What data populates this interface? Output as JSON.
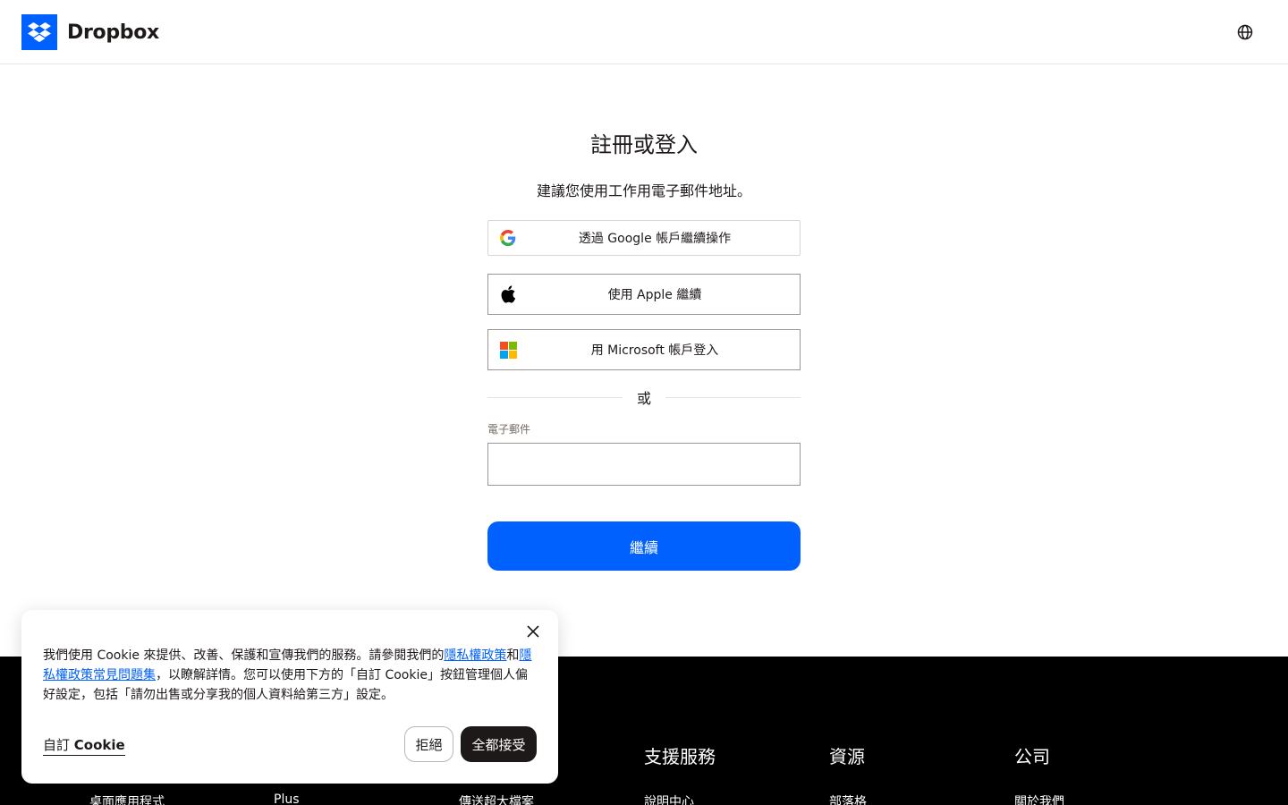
{
  "header": {
    "brand": "Dropbox",
    "globe_icon": "globe-icon"
  },
  "main": {
    "title": "註冊或登入",
    "subtitle": "建議您使用工作用電子郵件地址。",
    "google_label": "透過 Google 帳戶繼續操作",
    "apple_label": "使用 Apple 繼續",
    "microsoft_label": "用 Microsoft 帳戶登入",
    "or_label": "或",
    "email_label": "電子郵件",
    "email_value": "",
    "continue_label": "繼續"
  },
  "footer": {
    "columns": [
      {
        "heading": "支援服務",
        "first_link": "說明中心"
      },
      {
        "heading": "資源",
        "first_link": "部落格"
      },
      {
        "heading": "公司",
        "first_link": "關於我們"
      }
    ],
    "partial_links": [
      "桌面應用程式",
      "Plus",
      "傳送超大檔案"
    ]
  },
  "cookie": {
    "text_before": "我們使用 Cookie 來提供、改善、保護和宣傳我們的服務。請參閱我們的",
    "link1": "隱私權政策",
    "and": "和",
    "link2": "隱私權政策常見問題集",
    "text_after": "，以瞭解詳情。您可以使用下方的「自訂 Cookie」按鈕管理個人偏好設定，包括「請勿出售或分享我的個人資料給第三方」設定。",
    "customize_prefix": "自訂",
    "customize_bold": "Cookie",
    "reject_label": "拒絕",
    "accept_label": "全都接受"
  },
  "colors": {
    "brand_blue": "#0061fe",
    "dark": "#1e1919",
    "footer_bg": "#000000"
  }
}
